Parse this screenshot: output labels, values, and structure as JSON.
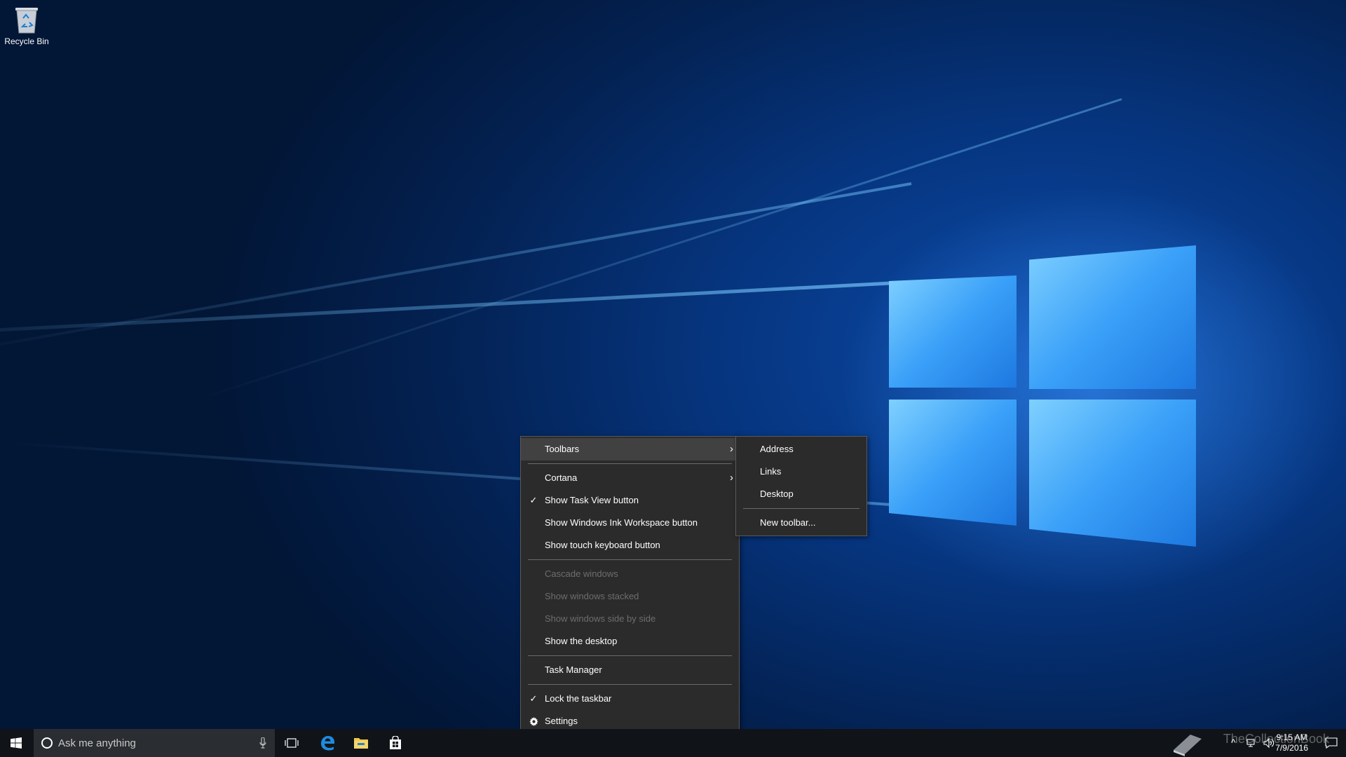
{
  "desktop": {
    "recycle_bin_label": "Recycle Bin"
  },
  "context_menu": {
    "items": [
      {
        "label": "Toolbars",
        "has_submenu": true
      },
      {
        "label": "Cortana",
        "has_submenu": true
      },
      {
        "label": "Show Task View button",
        "checked": true
      },
      {
        "label": "Show Windows Ink Workspace button"
      },
      {
        "label": "Show touch keyboard button"
      },
      {
        "label": "Cascade windows",
        "disabled": true
      },
      {
        "label": "Show windows stacked",
        "disabled": true
      },
      {
        "label": "Show windows side by side",
        "disabled": true
      },
      {
        "label": "Show the desktop"
      },
      {
        "label": "Task Manager"
      },
      {
        "label": "Lock the taskbar",
        "checked": true
      },
      {
        "label": "Settings",
        "icon": "gear-icon"
      }
    ],
    "check_glyph": "✓",
    "arrow_glyph": "›"
  },
  "toolbars_submenu": {
    "items": [
      {
        "label": "Address"
      },
      {
        "label": "Links"
      },
      {
        "label": "Desktop"
      },
      {
        "label": "New toolbar..."
      }
    ]
  },
  "taskbar": {
    "search_placeholder": "Ask me anything",
    "pinned": [
      "task-view-icon",
      "edge-icon",
      "file-explorer-icon",
      "store-icon"
    ],
    "clock_time": "9:15 AM",
    "clock_date": "7/9/2016",
    "watermark": "TheCollectionBook"
  },
  "colors": {
    "taskbar": "#101418",
    "menu_bg": "#2b2b2b",
    "menu_highlight": "#414141",
    "disabled_text": "#6d6d6d"
  }
}
